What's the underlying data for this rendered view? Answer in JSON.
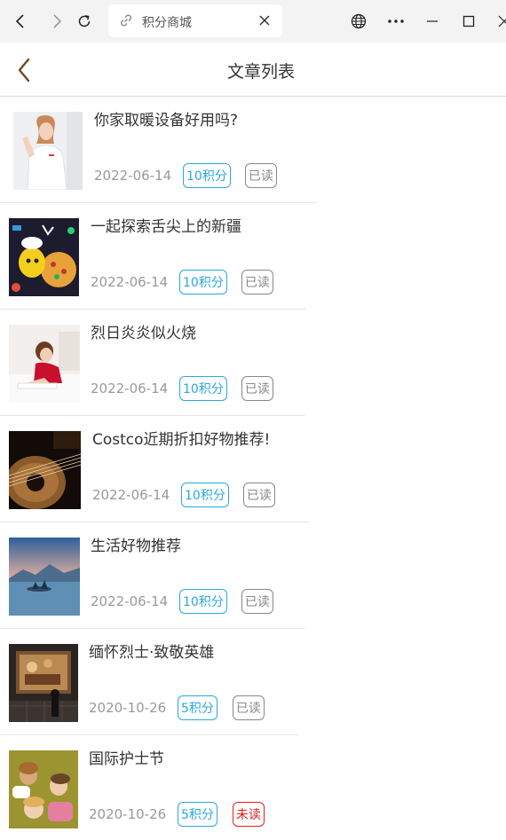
{
  "browser": {
    "tab_title": "积分商城",
    "icons": {
      "back": "arrow-left-icon",
      "forward": "arrow-right-icon",
      "reload": "reload-icon",
      "tab_link": "link-icon",
      "tab_close": "close-icon",
      "language": "globe-icon",
      "more": "more-icon",
      "minimize": "minimize-icon",
      "maximize": "maximize-icon",
      "close_window": "close-window-icon"
    }
  },
  "header": {
    "title": "文章列表",
    "back_icon": "chevron-left-icon"
  },
  "articles": [
    {
      "title": "你家取暖设备好用吗?",
      "date": "2022-06-14",
      "points": "10积分",
      "status": "已读",
      "read": true,
      "image": "girl-white-shirt"
    },
    {
      "title": "一起探索舌尖上的新疆",
      "date": "2022-06-14",
      "points": "10积分",
      "status": "已读",
      "read": true,
      "image": "pizza-illustration"
    },
    {
      "title": "烈日炎炎似火烧",
      "date": "2022-06-14",
      "points": "10积分",
      "status": "已读",
      "read": true,
      "image": "child-drawing"
    },
    {
      "title": "Costco近期折扣好物推荐!",
      "date": "2022-06-14",
      "points": "10积分",
      "status": "已读",
      "read": true,
      "image": "guitar-closeup"
    },
    {
      "title": "生活好物推荐",
      "date": "2022-06-14",
      "points": "10积分",
      "status": "已读",
      "read": true,
      "image": "lake-landscape"
    },
    {
      "title": "缅怀烈士·致敬英雄",
      "date": "2020-10-26",
      "points": "5积分",
      "status": "已读",
      "read": true,
      "image": "museum-painting"
    },
    {
      "title": "国际护士节",
      "date": "2020-10-26",
      "points": "5积分",
      "status": "未读",
      "read": false,
      "image": "children-on-grass"
    }
  ],
  "colors": {
    "accent_blue": "#29a8e0",
    "unread_red": "#e02020",
    "read_gray": "#888888",
    "back_arrow": "#6b4a1f"
  }
}
